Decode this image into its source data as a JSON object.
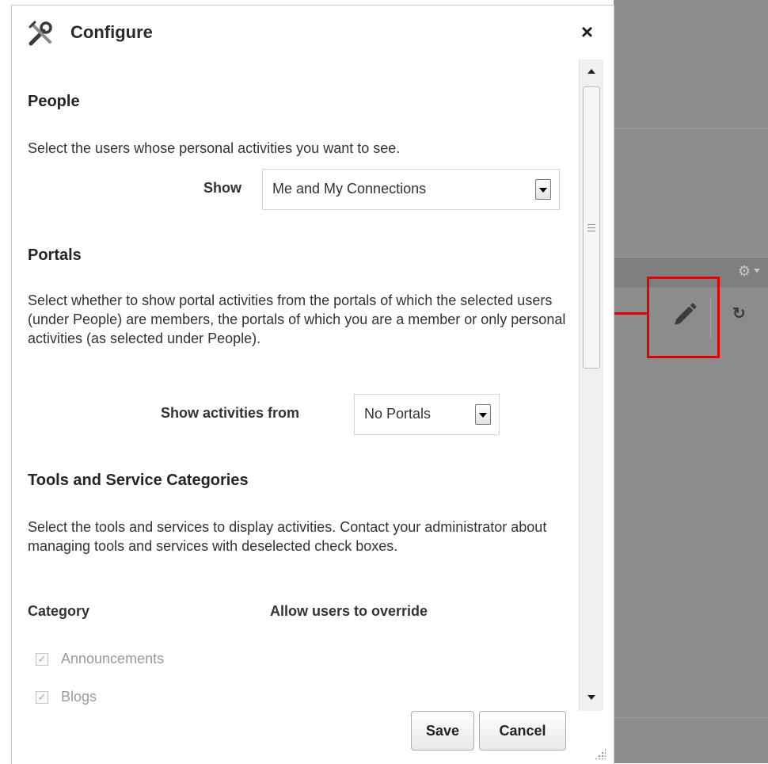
{
  "dialog": {
    "title": "Configure",
    "close_label": "×",
    "save_label": "Save",
    "cancel_label": "Cancel"
  },
  "people": {
    "heading": "People",
    "description": "Select the users whose personal activities you want to see.",
    "show_label": "Show",
    "show_value": "Me and My Connections"
  },
  "portals": {
    "heading": "Portals",
    "description": "Select whether to show portal activities from the portals of which the selected users (under People) are members, the portals of which you are a member or only personal activities (as selected under People).",
    "show_from_label": "Show activities from",
    "show_from_value": "No Portals"
  },
  "tools": {
    "heading": "Tools and Service Categories",
    "description": "Select the tools and services to display activities. Contact your administrator about managing tools and services with deselected check boxes.",
    "col_category": "Category",
    "col_override": "Allow users to override",
    "items": [
      {
        "label": "Announcements",
        "checked": true,
        "disabled": true
      },
      {
        "label": "Blogs",
        "checked": true,
        "disabled": true
      }
    ]
  },
  "icons": {
    "title": "tools-icon",
    "edit": "pencil-icon",
    "settings": "gear-icon",
    "refresh": "refresh-icon"
  },
  "colors": {
    "callout": "#e00000",
    "background_page": "#8c8c8c"
  }
}
